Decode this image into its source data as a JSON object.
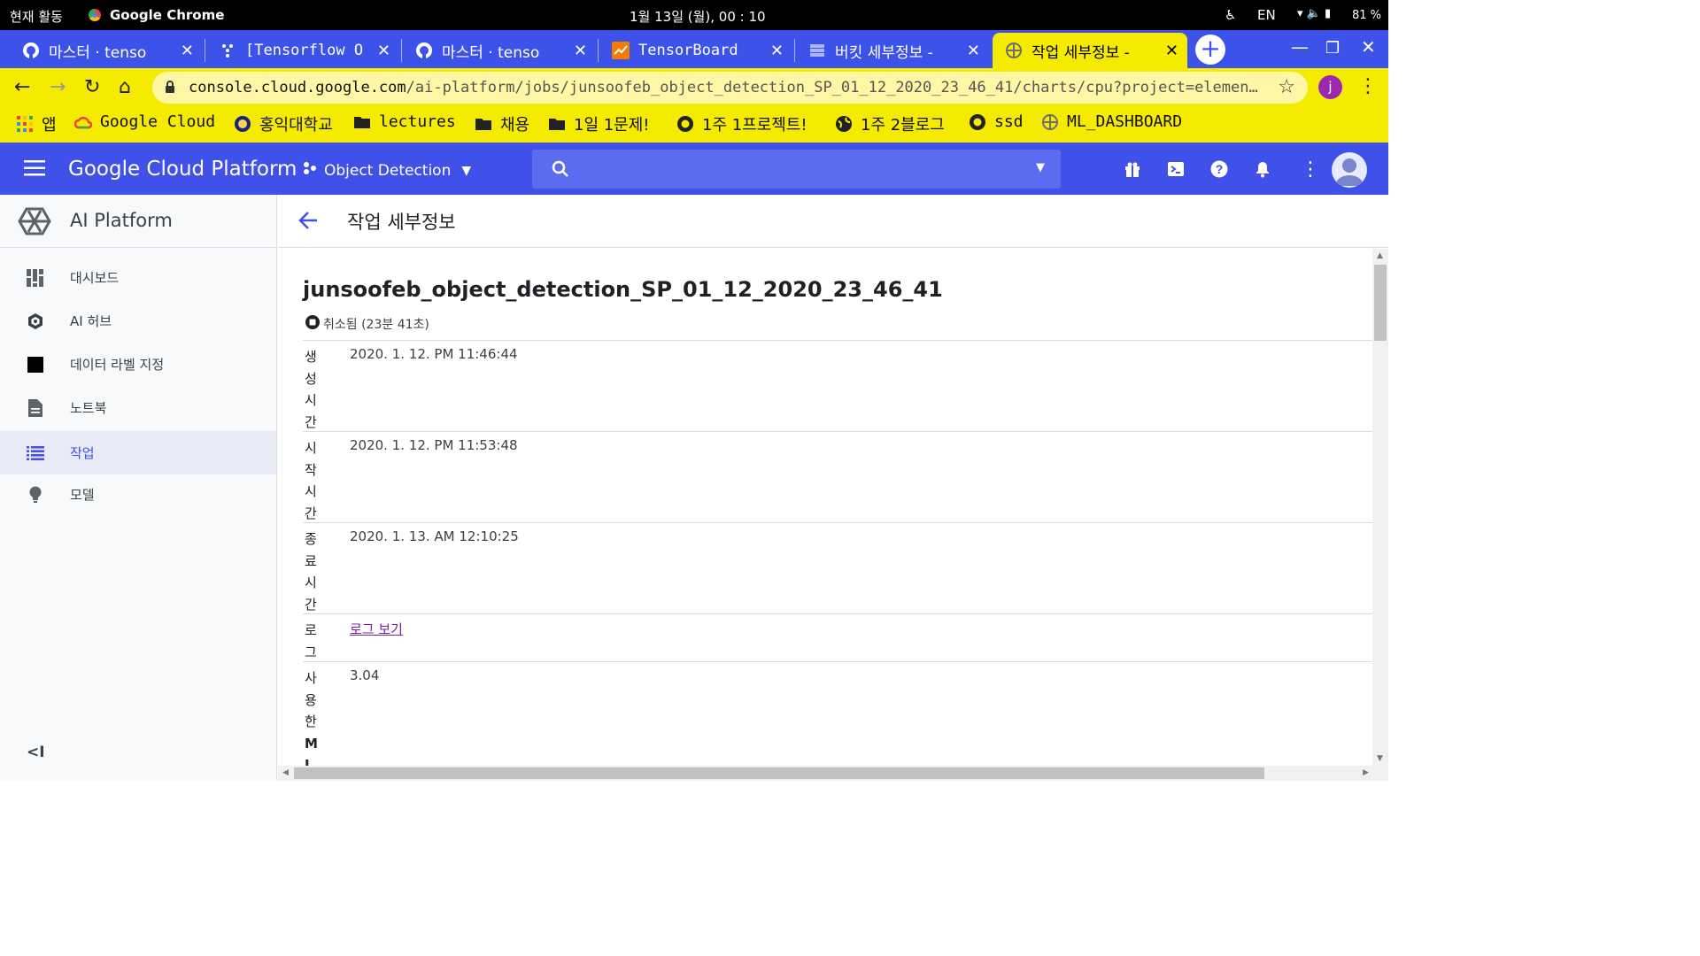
{
  "os": {
    "activities": "현재 활동",
    "app_name": "Google Chrome",
    "clock": "1월 13일 (월), 00 : 10",
    "lang": "EN",
    "battery": "81 %"
  },
  "tabs": [
    {
      "title": "마스터 · tenso",
      "icon": "github-icon",
      "active": false
    },
    {
      "title": "[Tensorflow O",
      "icon": "dots-icon",
      "active": false
    },
    {
      "title": "마스터 · tenso",
      "icon": "github-icon",
      "active": false
    },
    {
      "title": "TensorBoard",
      "icon": "tensorboard-icon",
      "active": false
    },
    {
      "title": "버킷 세부정보 -",
      "icon": "storage-icon",
      "active": false
    },
    {
      "title": "작업 세부정보 -",
      "icon": "ai-platform-icon",
      "active": true
    }
  ],
  "omnibox": {
    "host": "console.cloud.google.com",
    "path": "/ai-platform/jobs/junsoofeb_object_detection_SP_01_12_2020_23_46_41/charts/cpu?project=elemen…"
  },
  "profile_initial": "j",
  "bookmarks": [
    {
      "label": "앱",
      "icon": "apps-grid-icon"
    },
    {
      "label": "Google Cloud",
      "icon": "google-cloud-icon"
    },
    {
      "label": "홍익대학교",
      "icon": "university-seal-icon"
    },
    {
      "label": "lectures",
      "icon": "folder-icon"
    },
    {
      "label": "채용",
      "icon": "folder-icon"
    },
    {
      "label": "1일 1문제!",
      "icon": "folder-icon"
    },
    {
      "label": "1주 1프로젝트!",
      "icon": "github-icon"
    },
    {
      "label": "1주 2블로그",
      "icon": "globe-icon"
    },
    {
      "label": "ssd",
      "icon": "github-icon"
    },
    {
      "label": "ML_DASHBOARD",
      "icon": "ai-platform-icon"
    }
  ],
  "gcp": {
    "title": "Google Cloud Platform",
    "project": "Object Detection"
  },
  "sidebar": {
    "product": "AI Platform",
    "items": [
      {
        "label": "대시보드",
        "icon": "dashboard-icon",
        "active": false
      },
      {
        "label": "AI 허브",
        "icon": "ai-hub-icon",
        "active": false
      },
      {
        "label": "데이터 라벨 지정",
        "icon": "data-labeling-icon",
        "active": false
      },
      {
        "label": "노트북",
        "icon": "notebook-icon",
        "active": false
      },
      {
        "label": "작업",
        "icon": "jobs-list-icon",
        "active": true
      },
      {
        "label": "모델",
        "icon": "lightbulb-icon",
        "active": false
      }
    ],
    "collapse": "<I"
  },
  "page": {
    "title": "작업 세부정보",
    "job_name": "junsoofeb_object_detection_SP_01_12_2020_23_46_41",
    "status": "취소됨 (23분 41초)",
    "details": [
      {
        "label": "생성시간",
        "value": "2020. 1. 12. PM 11:46:44"
      },
      {
        "label": "시작시간",
        "value": "2020. 1. 12. PM 11:53:48"
      },
      {
        "label": "종료시간",
        "value": "2020. 1. 13. AM 12:10:25"
      },
      {
        "label": "로그",
        "value": "로그 보기"
      },
      {
        "label": "사용한ML단",
        "value": "3.04"
      }
    ]
  },
  "colors": {
    "tab_strip": "#3c52e9",
    "chrome_theme": "#f5eb00",
    "gcp_header": "#3f51e8",
    "active_nav": "#3f51e8",
    "link": "#7b1fa2"
  }
}
